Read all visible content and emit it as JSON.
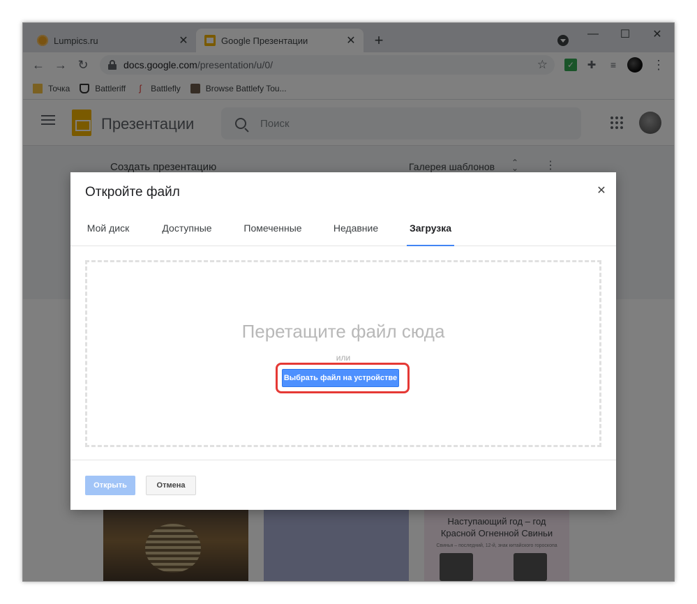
{
  "browser": {
    "tabs": [
      {
        "title": "Lumpics.ru",
        "icon": "lumpics-favicon"
      },
      {
        "title": "Google Презентации",
        "icon": "slides-favicon"
      }
    ],
    "url_host": "docs.google.com",
    "url_path": "/presentation/u/0/"
  },
  "bookmarks": [
    {
      "label": "Точка",
      "icon": "folder-icon"
    },
    {
      "label": "Battleriff",
      "icon": "battleriff-icon"
    },
    {
      "label": "Battlefly",
      "icon": "battlefly-icon"
    },
    {
      "label": "Browse Battlefy Tou...",
      "icon": "battlefy-icon"
    }
  ],
  "app": {
    "title": "Презентации",
    "search_placeholder": "Поиск",
    "create_label": "Создать презентацию",
    "gallery_label": "Галерея шаблонов"
  },
  "thumbnail": {
    "line1": "Наступающий год – год",
    "line2": "Красной Огненной Свиньи",
    "small": "Свинья – последний, 12-й, знак китайского гороскопа"
  },
  "dialog": {
    "title": "Откройте файл",
    "tabs": [
      "Мой диск",
      "Доступные",
      "Помеченные",
      "Недавние",
      "Загрузка"
    ],
    "active_tab": "Загрузка",
    "drop_text": "Перетащите файл сюда",
    "or_text": "или",
    "choose_button": "Выбрать файл на устройстве",
    "open_button": "Открыть",
    "cancel_button": "Отмена"
  },
  "colors": {
    "accent": "#4285f4",
    "highlight": "#e53935",
    "slides_yellow": "#f4b400"
  }
}
